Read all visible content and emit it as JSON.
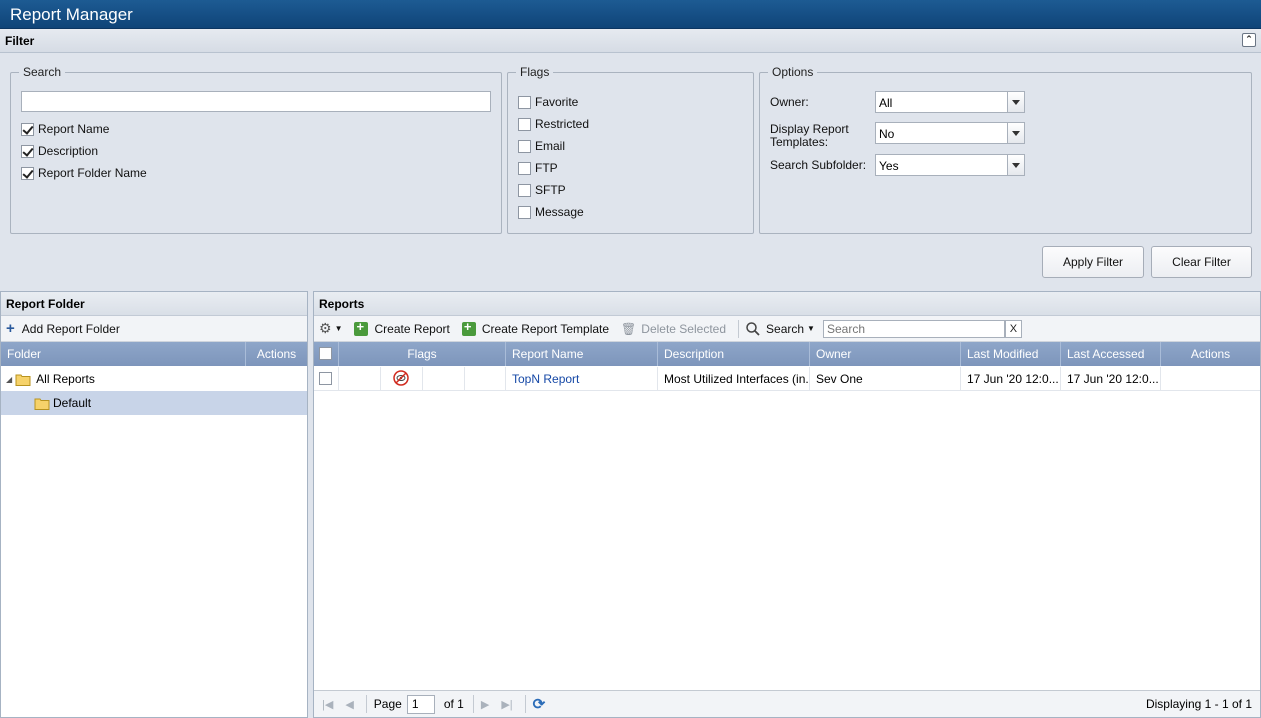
{
  "app": {
    "title": "Report Manager"
  },
  "filter": {
    "title": "Filter",
    "search": {
      "legend": "Search",
      "value": "",
      "placeholder": "",
      "options": [
        {
          "label": "Report Name",
          "checked": true
        },
        {
          "label": "Description",
          "checked": true
        },
        {
          "label": "Report Folder Name",
          "checked": true
        }
      ]
    },
    "flags": {
      "legend": "Flags",
      "options": [
        {
          "label": "Favorite",
          "checked": false
        },
        {
          "label": "Restricted",
          "checked": false
        },
        {
          "label": "Email",
          "checked": false
        },
        {
          "label": "FTP",
          "checked": false
        },
        {
          "label": "SFTP",
          "checked": false
        },
        {
          "label": "Message",
          "checked": false
        }
      ]
    },
    "options": {
      "legend": "Options",
      "owner_label": "Owner:",
      "owner_value": "All",
      "templates_label": "Display Report Templates:",
      "templates_value": "No",
      "subfolder_label": "Search Subfolder:",
      "subfolder_value": "Yes"
    },
    "apply_label": "Apply Filter",
    "clear_label": "Clear Filter"
  },
  "folder_panel": {
    "title": "Report Folder",
    "add_label": "Add Report Folder",
    "columns": [
      "Folder",
      "Actions"
    ],
    "tree": [
      {
        "label": "All Reports",
        "expanded": true
      },
      {
        "label": "Default",
        "selected": true
      }
    ]
  },
  "reports_panel": {
    "title": "Reports",
    "toolbar": {
      "create_report": "Create Report",
      "create_template": "Create Report Template",
      "delete_selected": "Delete Selected",
      "search_menu": "Search",
      "search_placeholder": "Search",
      "clear": "X"
    },
    "columns": [
      "Flags",
      "Report Name",
      "Description",
      "Owner",
      "Last Modified",
      "Last Accessed",
      "Actions"
    ],
    "rows": [
      {
        "name": "TopN Report",
        "description": "Most Utilized Interfaces (in...",
        "owner": "Sev One",
        "last_modified": "17 Jun '20 12:0...",
        "last_accessed": "17 Jun '20 12:0..."
      }
    ],
    "paging": {
      "page_label": "Page",
      "page_value": "1",
      "of_label": "of 1",
      "display_text": "Displaying 1 - 1 of 1"
    }
  },
  "colors": {
    "titlebar": "#0f4478",
    "grid_header": "#8ea6c9",
    "link": "#1548a6",
    "flag_icon": "#d02a1e"
  }
}
